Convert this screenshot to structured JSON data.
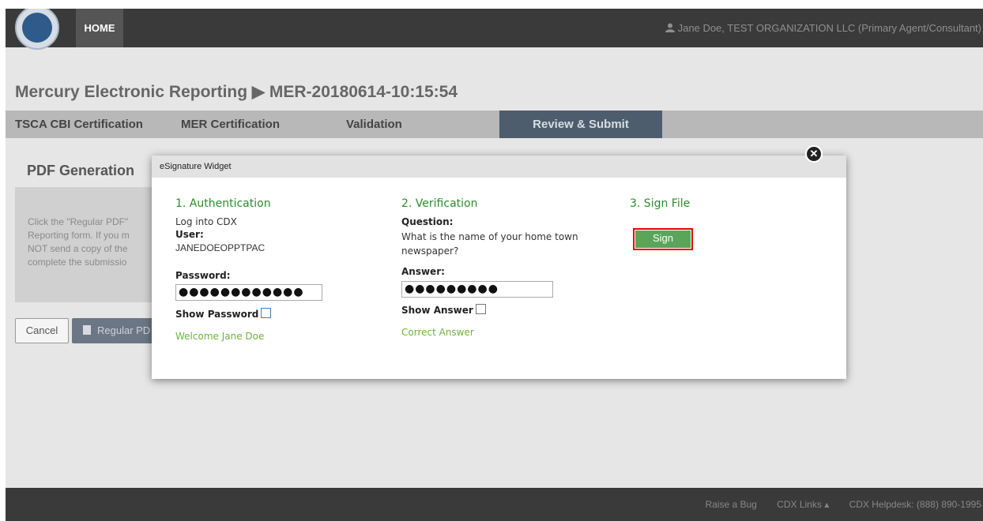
{
  "header": {
    "home_label": "HOME",
    "user_text": "Jane Doe, TEST ORGANIZATION LLC (Primary Agent/Consultant)"
  },
  "page": {
    "title": "Mercury Electronic Reporting ▶ MER-20180614-10:15:54"
  },
  "tabs": [
    {
      "label": "TSCA CBI Certification"
    },
    {
      "label": "MER Certification"
    },
    {
      "label": "Validation"
    },
    {
      "label": "Review & Submit"
    }
  ],
  "background_content": {
    "section_title": "PDF Generation",
    "text_lines": [
      "Click the \"Regular PDF\"",
      "Reporting form. If you m",
      "NOT send a copy of the",
      "complete the submissio"
    ],
    "cancel_label": "Cancel",
    "regular_pdf_label": "Regular PD"
  },
  "modal": {
    "title": "eSignature Widget",
    "close_glyph": "✕",
    "authentication": {
      "title": "1. Authentication",
      "login_text": "Log into CDX",
      "user_label": "User:",
      "user_value": "JANEDOEOPPTPAC",
      "password_label": "Password:",
      "password_value": "●●●●●●●●●●●●",
      "show_password_label": "Show Password",
      "welcome_text": "Welcome Jane Doe"
    },
    "verification": {
      "title": "2. Verification",
      "question_label": "Question:",
      "question_line1": "What is the name of your home town",
      "question_line2": "newspaper?",
      "answer_label": "Answer:",
      "answer_value": "●●●●●●●●●",
      "show_answer_label": "Show Answer",
      "result_text": "Correct Answer"
    },
    "sign": {
      "title": "3. Sign File",
      "button_label": "Sign"
    }
  },
  "footer": {
    "raise_bug": "Raise a Bug",
    "cdx_links": "CDX Links ▴",
    "helpdesk": "CDX Helpdesk: (888) 890-1995"
  },
  "colors": {
    "accent_green": "#2c8c2c",
    "success_green": "#6cb33e",
    "sign_button": "#5aa55a",
    "highlight_red": "#e00000",
    "active_tab": "#4d5d6d"
  }
}
